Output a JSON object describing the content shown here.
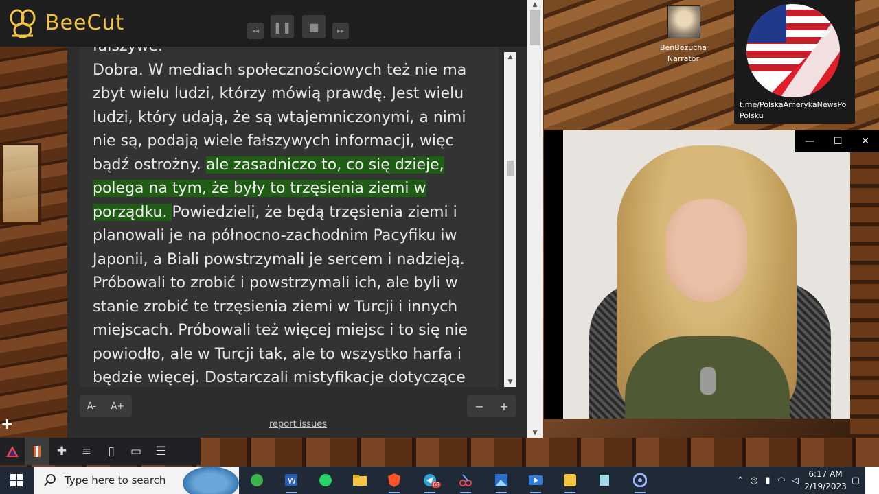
{
  "beecut": {
    "app_name": "BeeCut",
    "controls": {
      "rewind": "◂◂",
      "pause": "❚❚",
      "stop": "■",
      "forward": "▸▸"
    }
  },
  "reader": {
    "line_partial": "fałszywe.",
    "text_before": "Dobra. W mediach społecznościowych też nie ma zbyt wielu ludzi, którzy mówią prawdę. Jest wielu ludzi, który udają, że są wtajemniczonymi, a nimi nie są, podają wiele fałszywych informacji, więc bądź ostrożny. ",
    "text_highlight": "ale zasadniczo to, co się dzieje, polega na tym, że były to trzęsienia ziemi w porządku. ",
    "text_after": "Powiedzieli, że będą trzęsienia ziemi i planowali je na północno-zachodnim Pacyfiku iw Japonii, a Biali powstrzymali je sercem i nadzieją. Próbowali to zrobić i powstrzymali ich, ale byli w stanie zrobić te trzęsienia ziemi w Turcji i innych miejscach. Próbowali też więcej miejsc i to się nie powiodło, ale w Turcji tak, ale to wszystko harfa i będzie więcej. Dostarczali mistyfikacje dotyczące",
    "font_decrease": "A-",
    "font_increase": "A+",
    "zoom_out": "−",
    "zoom_in": "+",
    "report_link": "report issues"
  },
  "overlay": {
    "narrator_name": "BenBezucha",
    "narrator_role": "Narrator",
    "channel_link": "t.me/PolskaAmerykaNewsPo Polsku"
  },
  "video_window": {
    "minimize": "—",
    "maximize": "☐",
    "close": "✕"
  },
  "side_plus": "+",
  "taskbar": {
    "search_placeholder": "Type here to search",
    "time": "6:17 AM",
    "date": "2/19/2023",
    "telegram_badge": "68"
  },
  "colors": {
    "highlight": "#1f5c14",
    "beecut_gold": "#f5c542",
    "taskbar": "#1f2a36"
  }
}
